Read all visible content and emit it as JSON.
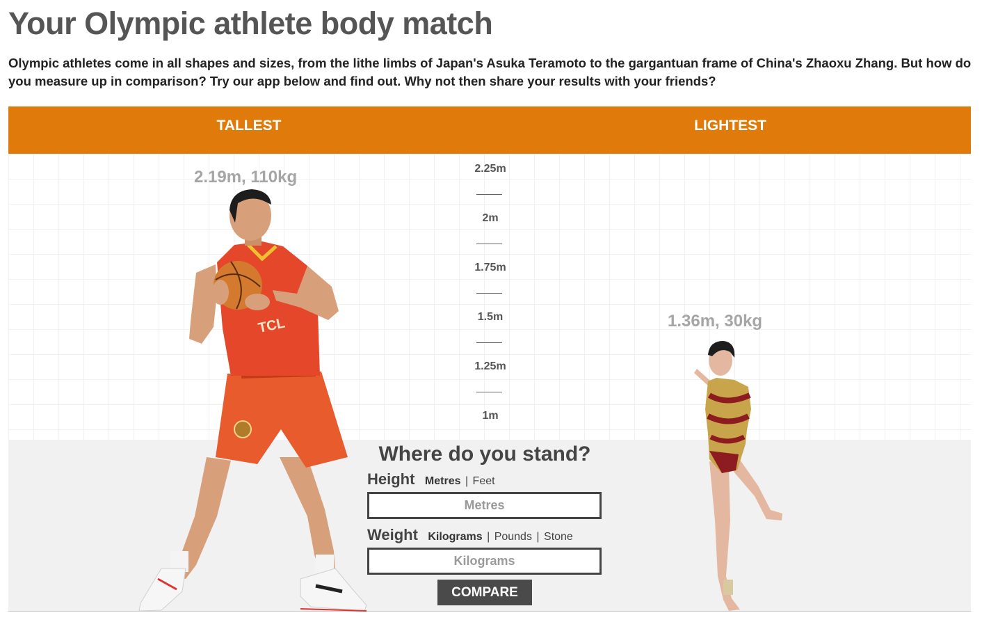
{
  "header": {
    "title": "Your Olympic athlete body match",
    "intro": "Olympic athletes come in all shapes and sizes, from the lithe limbs of Japan's Asuka Teramoto to the gargantuan frame of China's Zhaoxu Zhang. But how do you measure up in comparison? Try our app below and find out. Why not then share your results with your friends?"
  },
  "banner": {
    "left_label": "TALLEST",
    "right_label": "LIGHTEST",
    "color": "#e07a0a"
  },
  "scale": {
    "labels": [
      "2.25m",
      "2m",
      "1.75m",
      "1.5m",
      "1.25m",
      "1m"
    ]
  },
  "athletes": {
    "tallest": {
      "stat": "2.19m, 110kg"
    },
    "lightest": {
      "stat": "1.36m, 30kg"
    }
  },
  "form": {
    "title": "Where do you stand?",
    "height": {
      "label": "Height",
      "units": [
        "Metres",
        "Feet"
      ],
      "active_unit": "Metres",
      "placeholder": "Metres",
      "value": ""
    },
    "weight": {
      "label": "Weight",
      "units": [
        "Kilograms",
        "Pounds",
        "Stone"
      ],
      "active_unit": "Kilograms",
      "placeholder": "Kilograms",
      "value": ""
    },
    "button": "COMPARE"
  }
}
